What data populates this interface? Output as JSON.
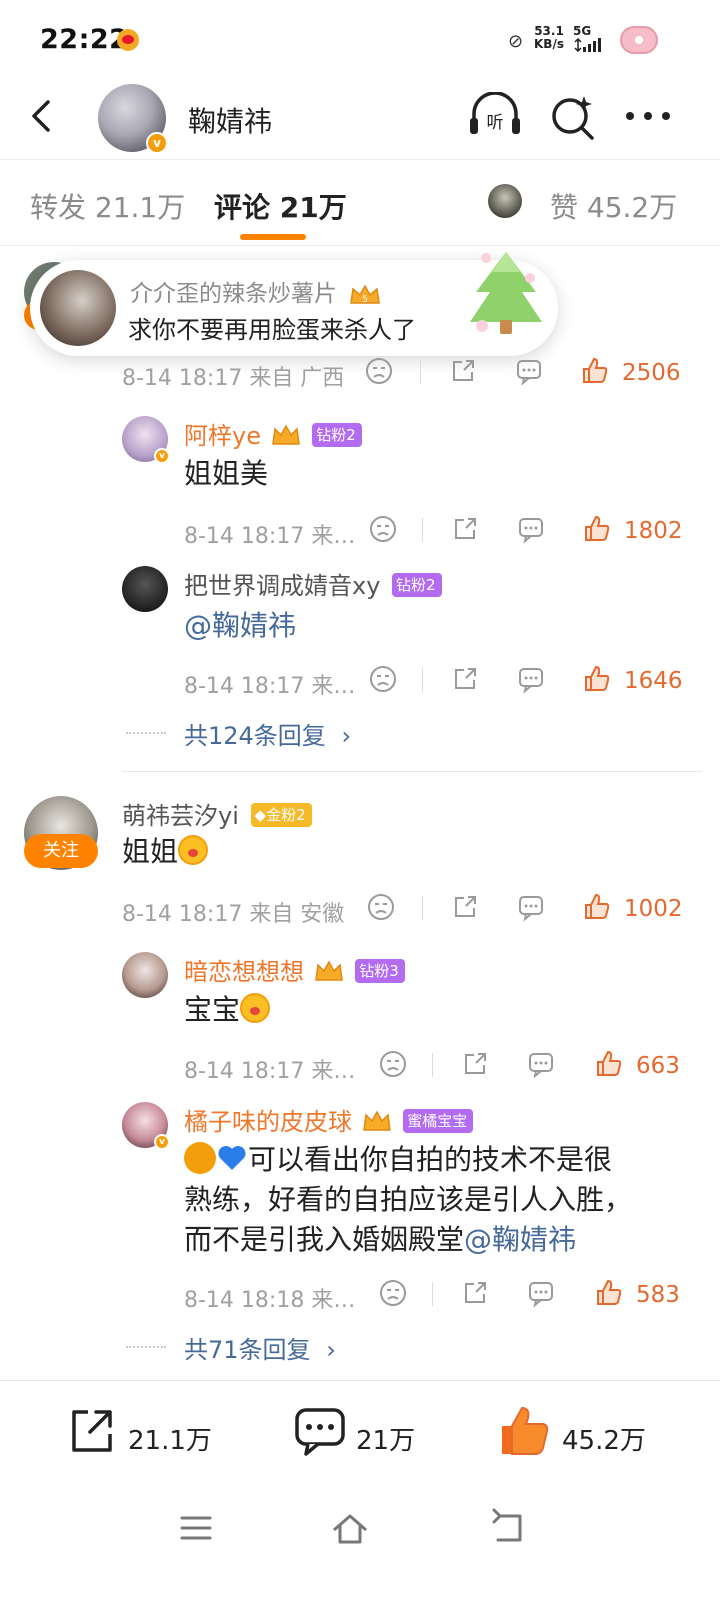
{
  "status_bar": {
    "time": "22:22",
    "speed_value": "53.1",
    "speed_unit": "KB/s",
    "network": "5G"
  },
  "header": {
    "user_name": "鞠婧祎",
    "verified_icon": "v-badge-icon",
    "listen_icon": "headphones-listen-icon",
    "search_icon": "search-sparkle-icon",
    "more_icon": "more-dots-icon"
  },
  "tabs": {
    "repost": "转发 21.1万",
    "comment": "评论 21万",
    "like": "赞 45.2万",
    "active": "comment",
    "accent_color": "#ff8200"
  },
  "toast": {
    "name": "介介歪的辣条炒薯片",
    "text": "求你不要再用脸蛋来杀人了"
  },
  "comments": [
    {
      "meta": {
        "date": "8-14 18:17 来自 广西",
        "likes": "2506"
      },
      "replies": [
        {
          "name": "阿梓ye",
          "badge": "钻粉2",
          "text": "姐姐美",
          "meta": {
            "date": "8-14 18:17 来…",
            "likes": "1802"
          }
        },
        {
          "name": "把世界调成婧音xy",
          "badge": "钻粉2",
          "text": "@鞠婧祎",
          "meta": {
            "date": "8-14 18:17 来…",
            "likes": "1646"
          }
        }
      ],
      "more_replies": "共124条回复"
    },
    {
      "name": "萌祎芸汐yi",
      "badge": "金粉2",
      "follow": "关注",
      "text": "姐姐",
      "meta": {
        "date": "8-14 18:17 来自 安徽",
        "likes": "1002"
      },
      "replies": [
        {
          "name": "暗恋想想想",
          "badge": "钻粉3",
          "text": "宝宝",
          "meta": {
            "date": "8-14 18:17 来…",
            "likes": "663"
          }
        },
        {
          "name": "橘子味的皮皮球",
          "badge": "蜜橘宝宝",
          "text_lines": [
            "可以看出你自拍的技术不是很",
            "熟练，好看的自拍应该是引人入胜，",
            "而不是引我入婚姻殿堂"
          ],
          "mention": "@鞠婧祎",
          "meta": {
            "date": "8-14 18:18 来…",
            "likes": "583"
          }
        }
      ],
      "more_replies": "共71条回复"
    }
  ],
  "bottom_bar": {
    "repost_count": "21.1万",
    "comment_count": "21万",
    "like_count": "45.2万"
  },
  "colors": {
    "orange_name": "#f0772a",
    "like_orange": "#e3692e",
    "link_blue": "#456a9a"
  }
}
